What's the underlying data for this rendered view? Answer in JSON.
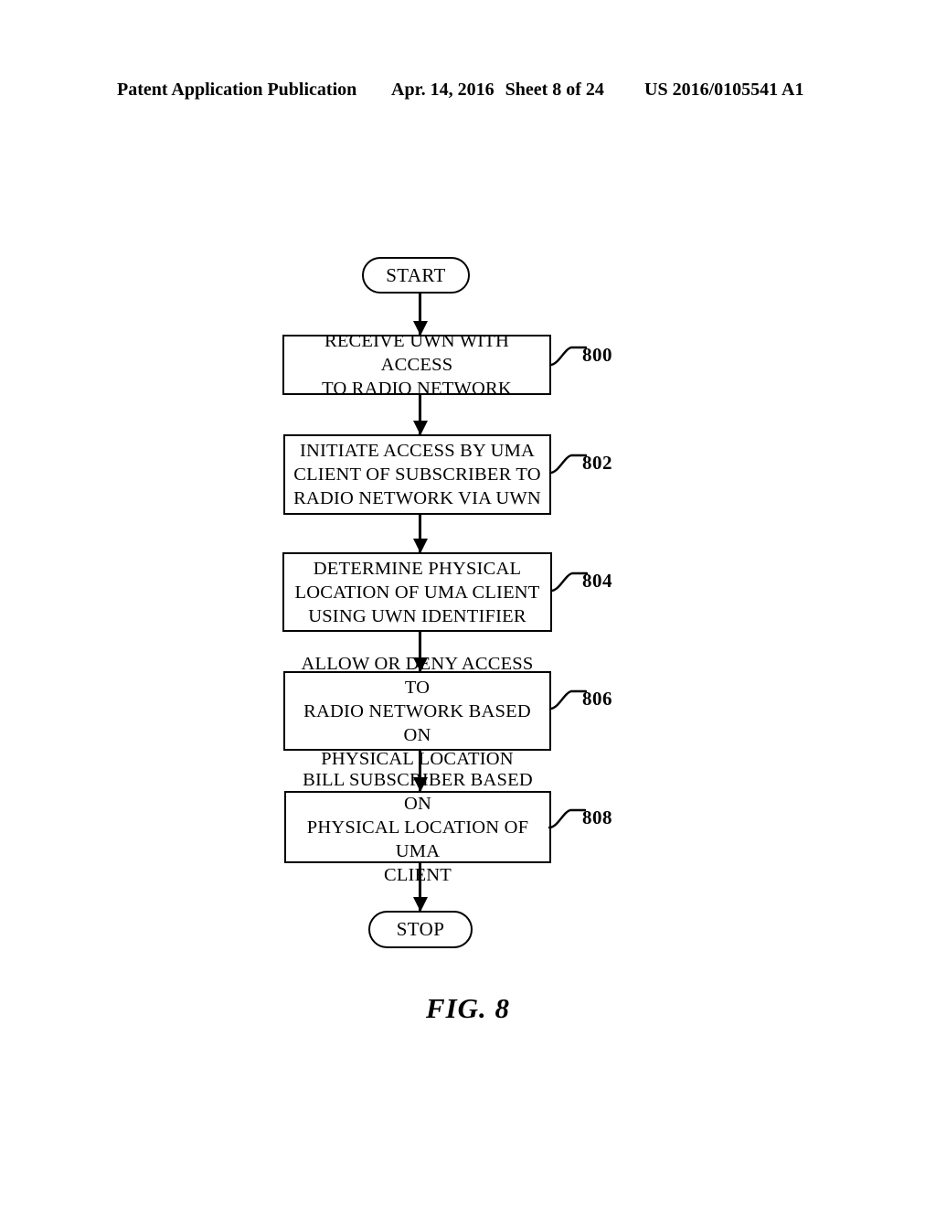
{
  "header": {
    "left": "Patent Application Publication",
    "date": "Apr. 14, 2016",
    "sheet": "Sheet 8 of 24",
    "publication_number": "US 2016/0105541 A1"
  },
  "figure": {
    "caption": "FIG. 8"
  },
  "flowchart": {
    "start_label": "START",
    "stop_label": "STOP",
    "steps": [
      {
        "ref": "800",
        "lines": [
          "RECEIVE UWN WITH ACCESS",
          "TO RADIO NETWORK"
        ],
        "text": "RECEIVE UWN WITH ACCESS TO RADIO NETWORK"
      },
      {
        "ref": "802",
        "lines": [
          "INITIATE ACCESS BY UMA",
          "CLIENT OF SUBSCRIBER TO",
          "RADIO NETWORK VIA UWN"
        ],
        "text": "INITIATE ACCESS BY UMA CLIENT OF SUBSCRIBER TO RADIO NETWORK VIA UWN"
      },
      {
        "ref": "804",
        "lines": [
          "DETERMINE PHYSICAL",
          "LOCATION OF UMA CLIENT",
          "USING UWN IDENTIFIER"
        ],
        "text": "DETERMINE PHYSICAL LOCATION OF UMA CLIENT USING UWN IDENTIFIER"
      },
      {
        "ref": "806",
        "lines": [
          "ALLOW OR DENY ACCESS TO",
          "RADIO NETWORK BASED ON",
          "PHYSICAL LOCATION"
        ],
        "text": "ALLOW OR DENY ACCESS TO RADIO NETWORK BASED ON PHYSICAL LOCATION"
      },
      {
        "ref": "808",
        "lines": [
          "BILL SUBSCRIBER BASED ON",
          "PHYSICAL LOCATION OF UMA",
          "CLIENT"
        ],
        "text": "BILL SUBSCRIBER BASED ON PHYSICAL LOCATION OF UMA CLIENT"
      }
    ]
  },
  "colors": {
    "ink": "#000000",
    "paper": "#ffffff"
  }
}
